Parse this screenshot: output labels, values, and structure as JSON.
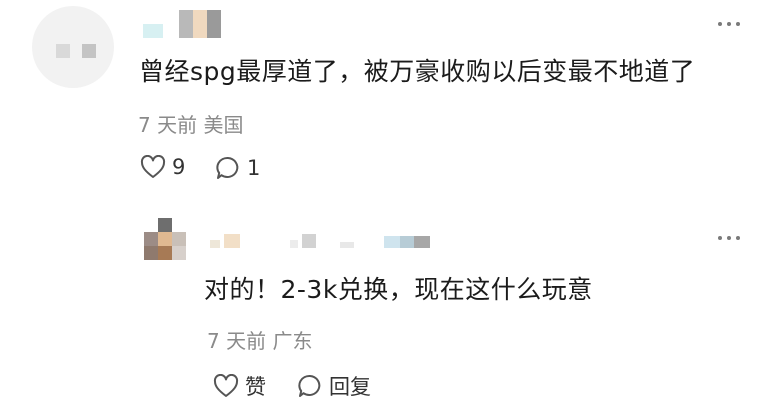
{
  "comment": {
    "text": "曾经spg最厚道了，被万豪收购以后变最不地道了",
    "time": "7 天前",
    "location": "美国",
    "likes": "9",
    "replies": "1"
  },
  "reply": {
    "text": "对的！2-3k兑换，现在这什么玩意",
    "time": "7 天前",
    "location": "广东",
    "like_label": "赞",
    "reply_label": "回复"
  },
  "icons": {
    "more": "more-dots-icon",
    "like": "heart-icon",
    "comment": "comment-bubble-icon"
  },
  "colors": {
    "meta": "#8a8a8a",
    "text": "#1b1b1b",
    "icon": "#555555"
  }
}
